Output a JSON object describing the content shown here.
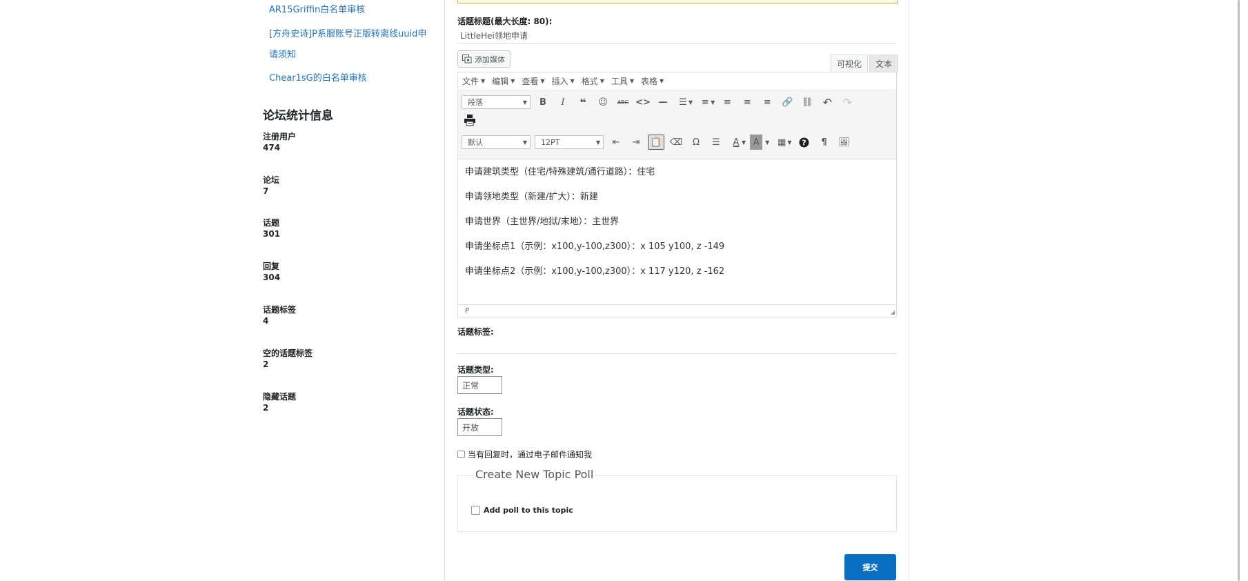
{
  "sidebar": {
    "links": [
      "AR15Griffin白名单审核",
      "[方舟史诗]P系服账号正版转离线uuid申",
      "请须知",
      "Chear1sG的白名单审核"
    ],
    "stats_title": "论坛统计信息",
    "stats": [
      {
        "label": "注册用户",
        "value": "474"
      },
      {
        "label": "论坛",
        "value": "7"
      },
      {
        "label": "话题",
        "value": "301"
      },
      {
        "label": "回复",
        "value": "304"
      },
      {
        "label": "话题标签",
        "value": "4"
      },
      {
        "label": "空的话题标签",
        "value": "2"
      },
      {
        "label": "隐藏话题",
        "value": "2"
      }
    ]
  },
  "form": {
    "title_label": "话题标题(最大长度: 80):",
    "title_value": "LittleHei领地申请",
    "add_media": "添加媒体",
    "tab_visual": "可视化",
    "tab_text": "文本",
    "menus": [
      "文件",
      "编辑",
      "查看",
      "插入",
      "格式",
      "工具",
      "表格"
    ],
    "format_select": "段落",
    "font_select": "默认",
    "size_select": "12PT",
    "content_lines": [
      "申请建筑类型（住宅/特殊建筑/通行道路）：住宅",
      "申请领地类型（新建/扩大）：新建",
      "申请世界（主世界/地狱/末地）：主世界",
      "申请坐标点1（示例：x100,y-100,z300）：x 105 y100, z -149",
      "申请坐标点2（示例：x100,y-100,z300）：x 117 y120, z -162"
    ],
    "status_path": "P",
    "tags_label": "话题标签:",
    "type_label": "话题类型:",
    "type_value": "正常",
    "status_label": "话题状态:",
    "status_value": "开放",
    "notify_label": "当有回复时，通过电子邮件通知我",
    "poll_legend": "Create New Topic Poll",
    "poll_checkbox": "Add poll to this topic",
    "submit_label": "提交"
  },
  "colors": {
    "link": "#2271b1",
    "submit_bg": "#0a6fc2",
    "notice_border": "#dba617"
  }
}
